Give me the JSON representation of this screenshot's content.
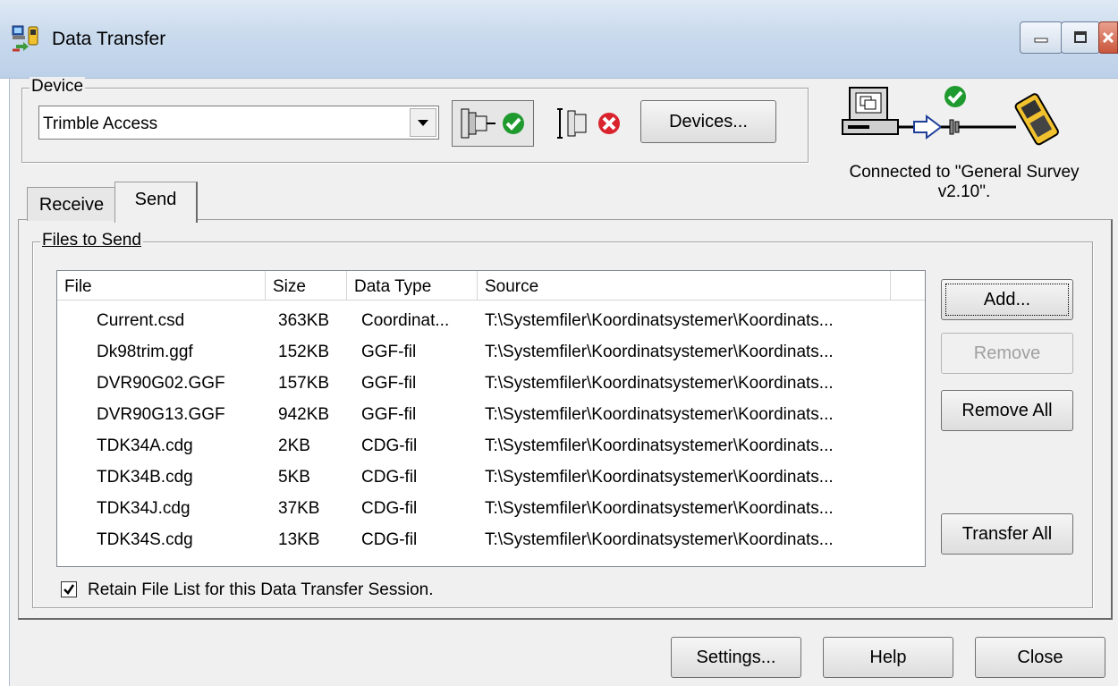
{
  "window": {
    "title": "Data Transfer"
  },
  "device": {
    "group_label": "Device",
    "selected": "Trimble Access",
    "connect_icon": "connect-icon",
    "disconnect_icon": "disconnect-icon",
    "devices_label": "Devices..."
  },
  "status": {
    "text": "Connected to \"General Survey v2.10\"."
  },
  "tabs": [
    {
      "label": "Receive"
    },
    {
      "label": "Send"
    }
  ],
  "files": {
    "group_label": "Files to Send",
    "columns": [
      "File",
      "Size",
      "Data Type",
      "Source"
    ],
    "rows": [
      {
        "file": "Current.csd",
        "size": "363KB",
        "type": "Coordinat...",
        "source": "T:\\Systemfiler\\Koordinatsystemer\\Koordinats..."
      },
      {
        "file": "Dk98trim.ggf",
        "size": "152KB",
        "type": "GGF-fil",
        "source": "T:\\Systemfiler\\Koordinatsystemer\\Koordinats..."
      },
      {
        "file": "DVR90G02.GGF",
        "size": "157KB",
        "type": "GGF-fil",
        "source": "T:\\Systemfiler\\Koordinatsystemer\\Koordinats..."
      },
      {
        "file": "DVR90G13.GGF",
        "size": "942KB",
        "type": "GGF-fil",
        "source": "T:\\Systemfiler\\Koordinatsystemer\\Koordinats..."
      },
      {
        "file": "TDK34A.cdg",
        "size": "2KB",
        "type": "CDG-fil",
        "source": "T:\\Systemfiler\\Koordinatsystemer\\Koordinats..."
      },
      {
        "file": "TDK34B.cdg",
        "size": "5KB",
        "type": "CDG-fil",
        "source": "T:\\Systemfiler\\Koordinatsystemer\\Koordinats..."
      },
      {
        "file": "TDK34J.cdg",
        "size": "37KB",
        "type": "CDG-fil",
        "source": "T:\\Systemfiler\\Koordinatsystemer\\Koordinats..."
      },
      {
        "file": "TDK34S.cdg",
        "size": "13KB",
        "type": "CDG-fil",
        "source": "T:\\Systemfiler\\Koordinatsystemer\\Koordinats..."
      }
    ]
  },
  "side_buttons": {
    "add": "Add...",
    "remove": "Remove",
    "remove_all": "Remove All",
    "transfer_all": "Transfer All"
  },
  "retain": {
    "checked": true,
    "label": "Retain File List for this Data Transfer Session."
  },
  "bottom_buttons": {
    "settings": "Settings...",
    "help": "Help",
    "close": "Close"
  }
}
